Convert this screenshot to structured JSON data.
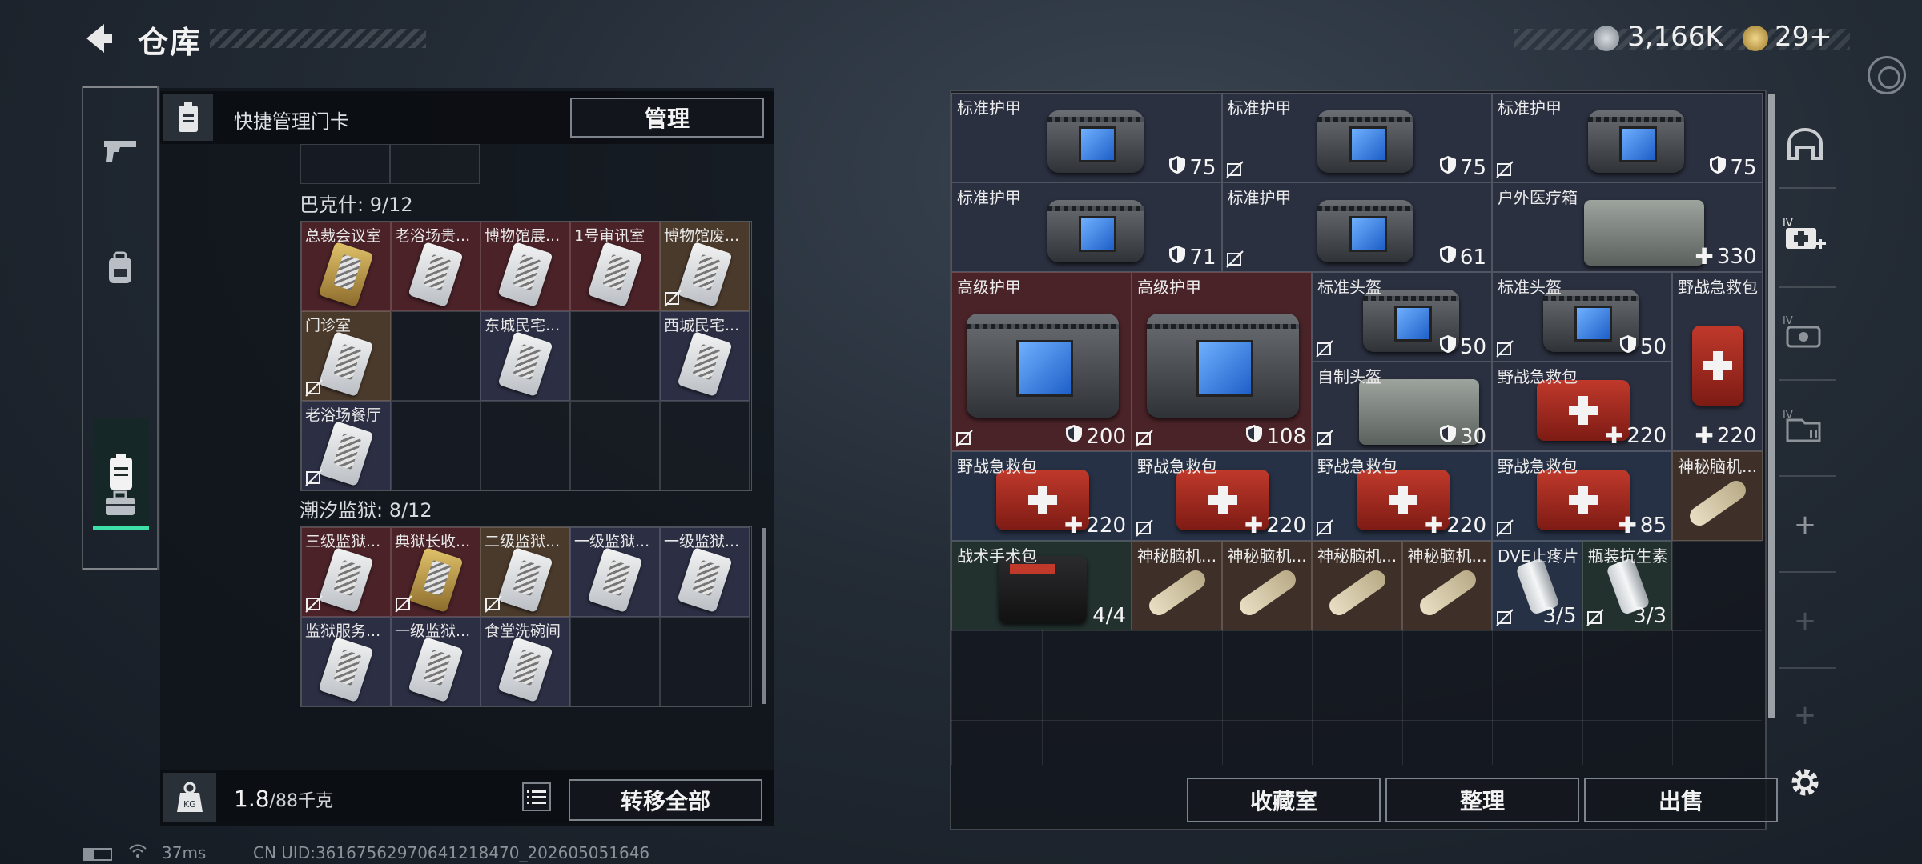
{
  "header": {
    "title": "仓库",
    "currency1": "3,166K",
    "currency2": "29+"
  },
  "quick_manage": {
    "label": "快捷管理门卡",
    "manage_button": "管理"
  },
  "sections": [
    {
      "title": "巴克什: 9/12",
      "keys": [
        {
          "name": "总裁会议室",
          "color": "red",
          "card": "gold",
          "nosell": false
        },
        {
          "name": "老浴场贵...",
          "color": "red",
          "card": "white",
          "nosell": false
        },
        {
          "name": "博物馆展...",
          "color": "red",
          "card": "white",
          "nosell": false
        },
        {
          "name": "1号审讯室",
          "color": "red",
          "card": "white",
          "nosell": false
        },
        {
          "name": "博物馆废...",
          "color": "brown",
          "card": "white",
          "nosell": true
        },
        {
          "name": "门诊室",
          "color": "brown",
          "card": "white",
          "nosell": true
        },
        {
          "name": "",
          "color": "empty",
          "card": "",
          "nosell": false
        },
        {
          "name": "东城民宅...",
          "color": "blue",
          "card": "white",
          "nosell": false
        },
        {
          "name": "",
          "color": "empty",
          "card": "",
          "nosell": false
        },
        {
          "name": "西城民宅...",
          "color": "blue",
          "card": "white",
          "nosell": false
        },
        {
          "name": "老浴场餐厅",
          "color": "blue",
          "card": "white",
          "nosell": true
        }
      ]
    },
    {
      "title": "潮汐监狱: 8/12",
      "keys": [
        {
          "name": "三级监狱...",
          "color": "red",
          "card": "white",
          "nosell": true
        },
        {
          "name": "典狱长收...",
          "color": "red",
          "card": "gold",
          "nosell": true
        },
        {
          "name": "二级监狱...",
          "color": "brown",
          "card": "white",
          "nosell": true
        },
        {
          "name": "一级监狱...",
          "color": "blue",
          "card": "white",
          "nosell": false
        },
        {
          "name": "一级监狱...",
          "color": "blue",
          "card": "white",
          "nosell": false
        },
        {
          "name": "监狱服务...",
          "color": "blue",
          "card": "white",
          "nosell": false
        },
        {
          "name": "一级监狱...",
          "color": "blue",
          "card": "white",
          "nosell": false
        },
        {
          "name": "食堂洗碗间",
          "color": "blue",
          "card": "white",
          "nosell": false
        }
      ]
    }
  ],
  "footer": {
    "weight_value": "1.8",
    "weight_cap": "/88千克",
    "transfer_all": "转移全部"
  },
  "items": [
    {
      "name": "标准护甲",
      "value": "75",
      "kind": "armor",
      "nosell": false
    },
    {
      "name": "标准护甲",
      "value": "75",
      "kind": "armor",
      "nosell": true
    },
    {
      "name": "标准护甲",
      "value": "75",
      "kind": "armor",
      "nosell": true
    },
    {
      "name": "标准护甲",
      "value": "71",
      "kind": "armor",
      "nosell": false
    },
    {
      "name": "标准护甲",
      "value": "61",
      "kind": "armor",
      "nosell": true
    },
    {
      "name": "户外医疗箱",
      "value": "330",
      "kind": "heal",
      "nosell": false
    },
    {
      "name": "高级护甲",
      "value": "200",
      "kind": "armor",
      "nosell": true
    },
    {
      "name": "高级护甲",
      "value": "108",
      "kind": "armor",
      "nosell": true
    },
    {
      "name": "标准头盔",
      "value": "50",
      "kind": "armor",
      "nosell": true
    },
    {
      "name": "标准头盔",
      "value": "50",
      "kind": "armor",
      "nosell": true
    },
    {
      "name": "野战急救包",
      "value": "220",
      "kind": "heal",
      "nosell": false
    },
    {
      "name": "自制头盔",
      "value": "30",
      "kind": "armor",
      "nosell": true
    },
    {
      "name": "野战急救包",
      "value": "220",
      "kind": "heal",
      "nosell": false
    },
    {
      "name": "野战急救包",
      "value": "220",
      "kind": "heal",
      "nosell": false
    },
    {
      "name": "野战急救包",
      "value": "220",
      "kind": "heal",
      "nosell": true
    },
    {
      "name": "野战急救包",
      "value": "220",
      "kind": "heal",
      "nosell": true
    },
    {
      "name": "野战急救包",
      "value": "85",
      "kind": "heal",
      "nosell": true
    },
    {
      "name": "神秘脑机...",
      "value": "",
      "kind": "none",
      "nosell": false
    },
    {
      "name": "战术手术包",
      "value": "4/4",
      "kind": "count",
      "nosell": false
    },
    {
      "name": "神秘脑机...",
      "value": "",
      "kind": "none",
      "nosell": false
    },
    {
      "name": "神秘脑机...",
      "value": "",
      "kind": "none",
      "nosell": false
    },
    {
      "name": "神秘脑机...",
      "value": "",
      "kind": "none",
      "nosell": false
    },
    {
      "name": "神秘脑机...",
      "value": "",
      "kind": "none",
      "nosell": false
    },
    {
      "name": "DVE止疼片",
      "value": "3/5",
      "kind": "count",
      "nosell": true
    },
    {
      "name": "瓶装抗生素",
      "value": "3/3",
      "kind": "count",
      "nosell": true
    }
  ],
  "bottom_buttons": {
    "collection": "收藏室",
    "organize": "整理",
    "sell": "出售"
  },
  "status": {
    "ping": "37ms",
    "uid": "CN UID:36167562970641218470_202605051646"
  },
  "colors": {
    "accent": "#3de0a6",
    "rarity_red": "#4a2328",
    "rarity_blue": "#2b3040",
    "rarity_brown": "#3e3028",
    "rarity_green": "#22302e"
  }
}
